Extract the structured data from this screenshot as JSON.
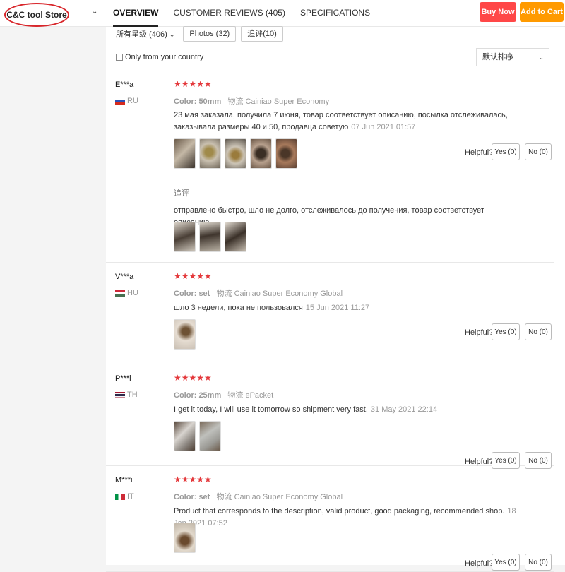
{
  "header": {
    "store_name": "C&C tool Store",
    "tabs": [
      {
        "label": "OVERVIEW",
        "active": true
      },
      {
        "label": "CUSTOMER REVIEWS (405)",
        "active": false
      },
      {
        "label": "SPECIFICATIONS",
        "active": false
      }
    ],
    "buy_now": "Buy Now",
    "add_to_cart": "Add to Cart"
  },
  "filters": {
    "rating": "所有星级 (406)",
    "photos": "Photos (32)",
    "append": "追评(10)",
    "only_country": "Only from your country",
    "sort": "默认排序"
  },
  "labels": {
    "helpful": "Helpful?",
    "yes": "Yes (0)",
    "no": "No (0)",
    "stars": "★★★★★",
    "append_title": "追评"
  },
  "reviews": [
    {
      "name": "E***a",
      "country": "RU",
      "color": "Color: 50mm",
      "logistics": "物流 Cainiao Super Economy",
      "text": "23 мая заказала, получила 7 июня, товар соответствует описанию, посылка отслеживалась, заказывала размеры 40 и 50, продавца советую",
      "date": "07 Jun 2021 01:57",
      "append": "отправлено быстро, шло не долго, отслеживалось до получения, товар соответствует описанию"
    },
    {
      "name": "V***a",
      "country": "HU",
      "color": "Color: set",
      "logistics": "物流 Cainiao Super Economy Global",
      "text": "шло 3 недели, пока не пользовался",
      "date": "15 Jun 2021 11:27"
    },
    {
      "name": "P***l",
      "country": "TH",
      "color": "Color: 25mm",
      "logistics": "物流 ePacket",
      "text": "I get it today, I will use it tomorrow so shipment very fast.",
      "date": "31 May 2021 22:14"
    },
    {
      "name": "M***i",
      "country": "IT",
      "color": "Color: set",
      "logistics": "物流 Cainiao Super Economy Global",
      "text": "Product that corresponds to the description, valid product, good packaging, recommended shop.",
      "date": "18 Jan 2021 07:52"
    }
  ],
  "colors": {
    "buy_now": "#ff4747",
    "add_to_cart": "#ff9a00",
    "stars": "#e4393c",
    "store_circle": "#d8262b"
  }
}
